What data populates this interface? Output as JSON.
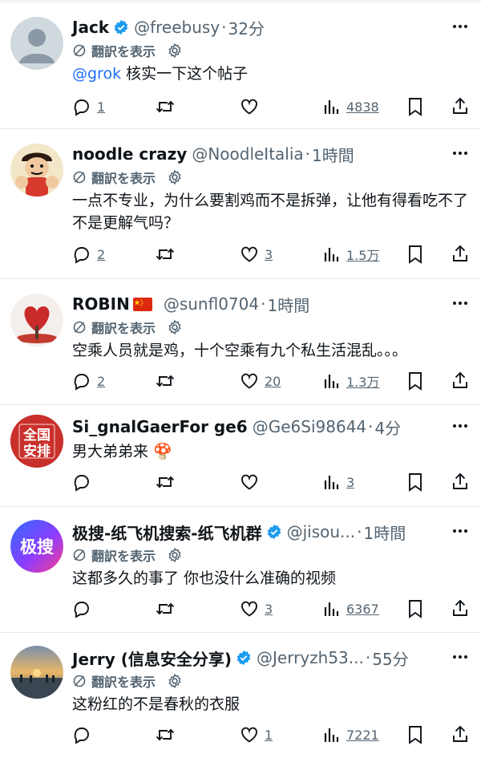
{
  "translate_label": "翻訳を表示",
  "tweets": [
    {
      "name": "Jack",
      "handle": "@freebusy",
      "time": "32分",
      "text_mention": "@grok",
      "text": "核实一下这个帖子",
      "reply_count": "1",
      "retweet_count": "",
      "like_count": "",
      "views": "4838"
    },
    {
      "name": "noodle crazy",
      "handle": "@NoodleItalia",
      "time": "1時間",
      "text": "一点不专业，为什么要割鸡而不是拆弹，让他有得看吃不了不是更解气吗？",
      "reply_count": "2",
      "retweet_count": "",
      "like_count": "3",
      "views": "1.5万"
    },
    {
      "name": "ROBIN",
      "handle": "@sunfl0704",
      "time": "1時間",
      "text": "空乘人员就是鸡，十个空乘有九个私生活混乱。。。",
      "reply_count": "2",
      "retweet_count": "",
      "like_count": "20",
      "views": "1.3万"
    },
    {
      "name": "Si_gnalGaerFor ge6",
      "handle": "@Ge6Si98644",
      "time": "4分",
      "text": "男大弟弟来 🍄",
      "reply_count": "",
      "retweet_count": "",
      "like_count": "",
      "views": "3"
    },
    {
      "name": "极搜-纸飞机搜索-纸飞机群",
      "handle": "@jisou...",
      "time": "1時間",
      "text": "这都多久的事了 你也没什么准确的视频",
      "reply_count": "",
      "retweet_count": "",
      "like_count": "3",
      "views": "6367"
    },
    {
      "name": "Jerry (信息安全分享)",
      "handle": "@Jerryzh53...",
      "time": "55分",
      "text": "这粉红的不是春秋的衣服",
      "reply_count": "",
      "retweet_count": "",
      "like_count": "1",
      "views": "7221"
    }
  ],
  "avatars": {
    "t4_line1": "全国",
    "t4_line2": "安排",
    "t5_logo": "极搜"
  },
  "colors": {
    "verified": "#1d9bf0",
    "accent": "#1d6ffd",
    "muted": "#536471"
  }
}
